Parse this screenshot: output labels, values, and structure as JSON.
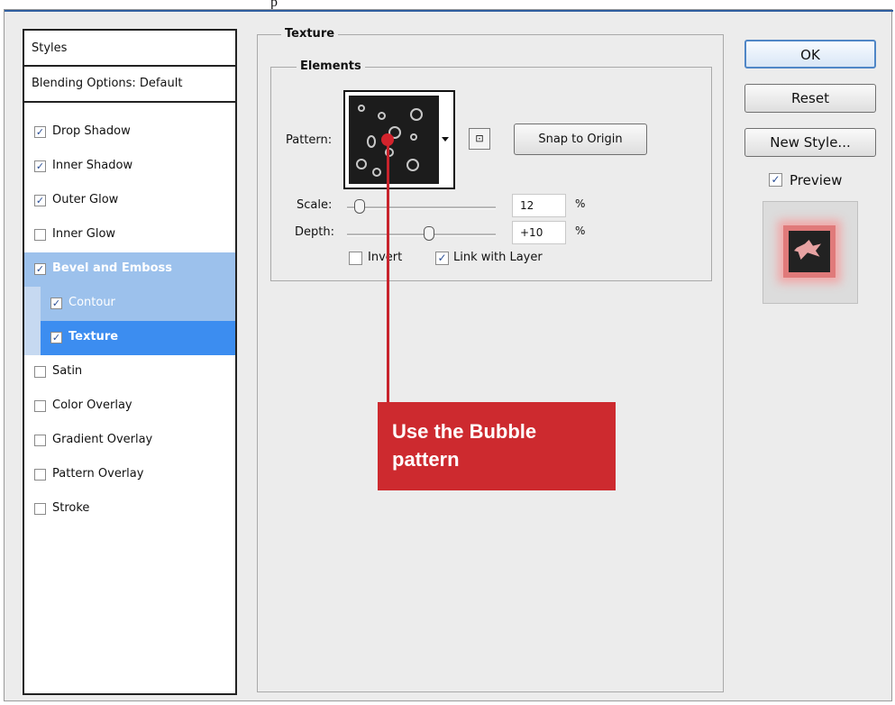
{
  "top_text": "p",
  "styles_panel": {
    "header": "Styles",
    "blending": "Blending Options: Default",
    "items": [
      {
        "label": "Drop Shadow",
        "checked": true
      },
      {
        "label": "Inner Shadow",
        "checked": true
      },
      {
        "label": "Outer Glow",
        "checked": true
      },
      {
        "label": "Inner Glow",
        "checked": false
      },
      {
        "label": "Bevel and Emboss",
        "checked": true
      },
      {
        "label": "Contour",
        "checked": true
      },
      {
        "label": "Texture",
        "checked": true
      },
      {
        "label": "Satin",
        "checked": false
      },
      {
        "label": "Color Overlay",
        "checked": false
      },
      {
        "label": "Gradient Overlay",
        "checked": false
      },
      {
        "label": "Pattern Overlay",
        "checked": false
      },
      {
        "label": "Stroke",
        "checked": false
      }
    ]
  },
  "texture": {
    "title": "Texture",
    "elements_title": "Elements",
    "pattern_label": "Pattern:",
    "new_preset_icon": "new-preset-icon",
    "snap_label": "Snap to Origin",
    "scale_label": "Scale:",
    "scale_value": "12",
    "scale_unit": "%",
    "depth_label": "Depth:",
    "depth_value": "+10",
    "depth_unit": "%",
    "invert_label": "Invert",
    "invert_checked": false,
    "link_label": "Link with Layer",
    "link_checked": true
  },
  "annotation": {
    "line1": "Use the Bubble",
    "line2": "pattern",
    "color": "#cd2a2f"
  },
  "buttons": {
    "ok": "OK",
    "reset": "Reset",
    "new_style": "New Style...",
    "preview_label": "Preview",
    "preview_checked": true
  },
  "check_mark": "✓"
}
